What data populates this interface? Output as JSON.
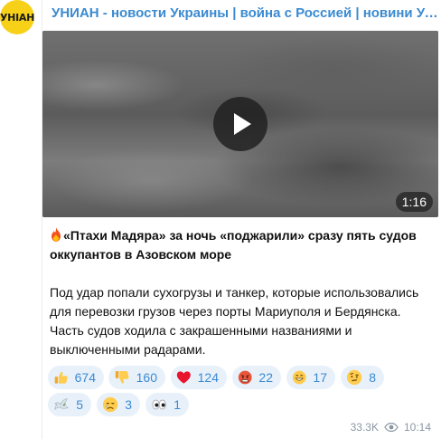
{
  "channel": {
    "logo_text": "УНІАН",
    "title": "УНИАН - новости Украины | война с Россией | новини Україні..."
  },
  "video": {
    "duration": "1:16"
  },
  "post": {
    "headline": "«Птахи Мадяра» за ночь «поджарили» сразу пять судов оккупантов в Азовском море",
    "body": "Под удар попали сухогрузы и танкер, которые использовались для перевозки грузов через порты Мариуполя и Бердянска. Часть судов ходила с закрашенными названиями и выключенными радарами."
  },
  "reactions": [
    {
      "icon": "thumbs-up",
      "count": "674"
    },
    {
      "icon": "thumbs-down",
      "count": "160"
    },
    {
      "icon": "red-heart",
      "count": "124"
    },
    {
      "icon": "angry-face",
      "count": "22"
    },
    {
      "icon": "grinning-face",
      "count": "17"
    },
    {
      "icon": "raised-eyebrow-face",
      "count": "8"
    },
    {
      "icon": "dove",
      "count": "5"
    },
    {
      "icon": "crying-face",
      "count": "3"
    },
    {
      "icon": "eyes",
      "count": "1"
    }
  ],
  "meta": {
    "views": "33.3K",
    "time": "10:14"
  },
  "colors": {
    "accent": "#3a8ad1",
    "reaction_bg": "#e8f1fa",
    "avatar_bg": "#f7d117"
  }
}
